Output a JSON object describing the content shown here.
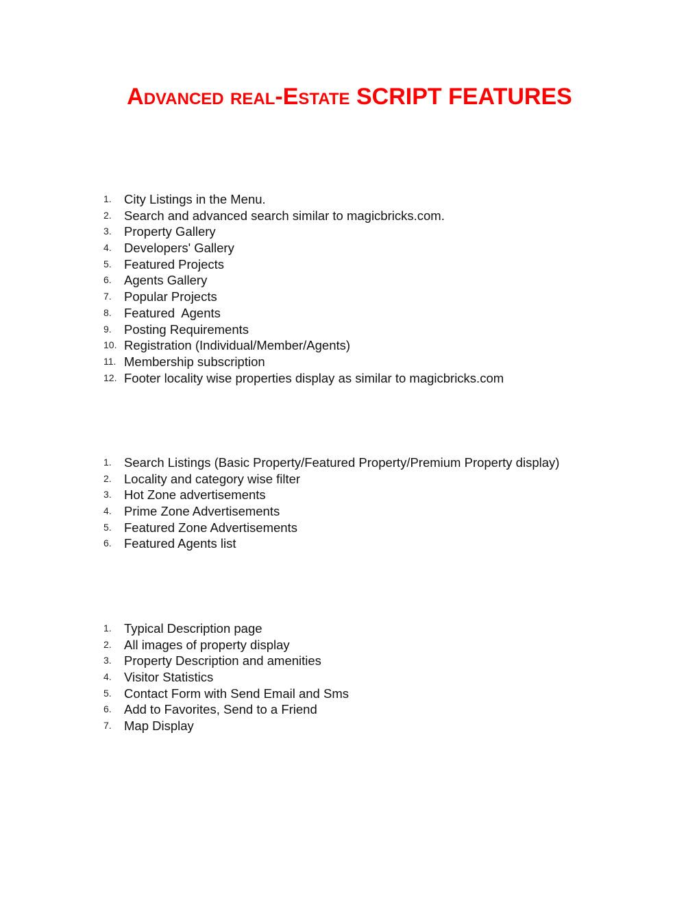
{
  "document": {
    "title": {
      "part1_initial": "A",
      "part1_rest": "dvanced real",
      "hyphen": "-",
      "part2_initial": "E",
      "part2_rest": "state",
      "part3": "SCRIPT FEATURES"
    },
    "title_color": "#ff0000",
    "sections": [
      {
        "items": [
          {
            "number": "1.",
            "text": "City Listings in the Menu."
          },
          {
            "number": "2.",
            "text": "Search and advanced search similar to magicbricks.com."
          },
          {
            "number": "3.",
            "text": "Property Gallery"
          },
          {
            "number": "4.",
            "text": "Developers' Gallery"
          },
          {
            "number": "5.",
            "text": "Featured Projects"
          },
          {
            "number": "6.",
            "text": "Agents Gallery"
          },
          {
            "number": "7.",
            "text": "Popular Projects"
          },
          {
            "number": "8.",
            "text": "Featured  Agents"
          },
          {
            "number": "9.",
            "text": "Posting Requirements"
          },
          {
            "number": "10.",
            "text": "Registration (Individual/Member/Agents)"
          },
          {
            "number": "11.",
            "text": "Membership subscription"
          },
          {
            "number": "12.",
            "text": "Footer locality wise properties display as similar to magicbricks.com"
          }
        ]
      },
      {
        "items": [
          {
            "number": "1.",
            "text": "Search Listings (Basic Property/Featured Property/Premium Property display)"
          },
          {
            "number": "2.",
            "text": "Locality and category wise filter"
          },
          {
            "number": "3.",
            "text": "Hot Zone advertisements"
          },
          {
            "number": "4.",
            "text": "Prime Zone Advertisements"
          },
          {
            "number": "5.",
            "text": "Featured Zone Advertisements"
          },
          {
            "number": "6.",
            "text": "Featured Agents list"
          }
        ]
      },
      {
        "items": [
          {
            "number": "1.",
            "text": "Typical Description page"
          },
          {
            "number": "2.",
            "text": "All images of property display"
          },
          {
            "number": "3.",
            "text": "Property Description and amenities"
          },
          {
            "number": "4.",
            "text": "Visitor Statistics"
          },
          {
            "number": "5.",
            "text": "Contact Form with Send Email and Sms"
          },
          {
            "number": "6.",
            "text": "Add to Favorites, Send to a Friend"
          },
          {
            "number": "7.",
            "text": "Map Display"
          }
        ]
      }
    ]
  }
}
